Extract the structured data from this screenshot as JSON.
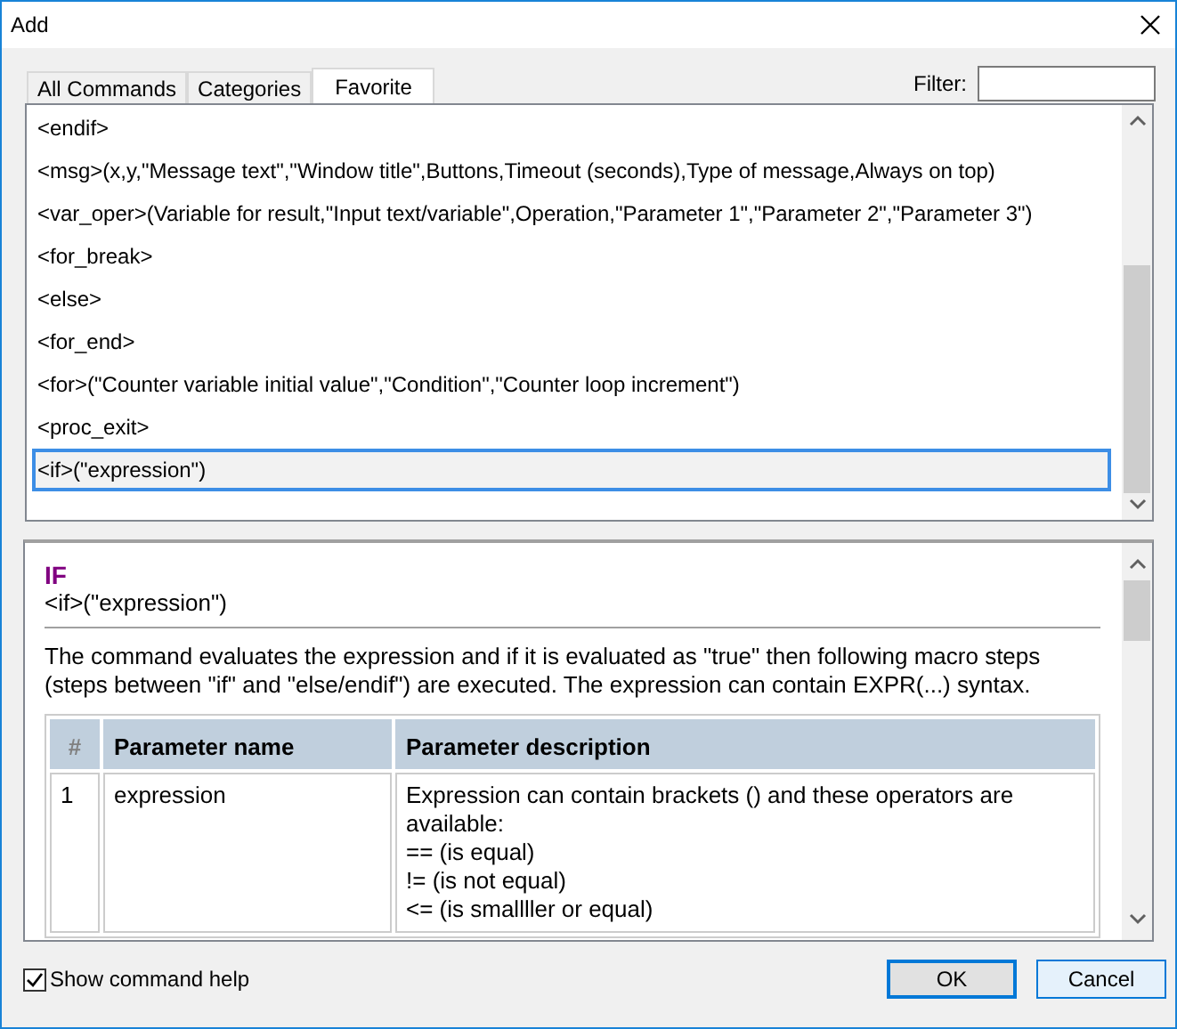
{
  "window": {
    "title": "Add"
  },
  "tabs": [
    {
      "label": "All Commands",
      "selected": false
    },
    {
      "label": "Categories",
      "selected": false
    },
    {
      "label": "Favorite",
      "selected": true
    }
  ],
  "filter": {
    "label": "Filter:"
  },
  "commands": [
    {
      "text": "<endif>",
      "selected": false
    },
    {
      "text": "<msg>(x,y,\"Message text\",\"Window title\",Buttons,Timeout (seconds),Type of message,Always on top)",
      "selected": false
    },
    {
      "text": "<var_oper>(Variable for result,\"Input text/variable\",Operation,\"Parameter 1\",\"Parameter 2\",\"Parameter 3\")",
      "selected": false
    },
    {
      "text": "<for_break>",
      "selected": false
    },
    {
      "text": "<else>",
      "selected": false
    },
    {
      "text": "<for_end>",
      "selected": false
    },
    {
      "text": "<for>(\"Counter variable initial value\",\"Condition\",\"Counter loop increment\")",
      "selected": false
    },
    {
      "text": "<proc_exit>",
      "selected": false
    },
    {
      "text": "<if>(\"expression\")",
      "selected": true
    }
  ],
  "help": {
    "title": "IF",
    "syntax": "<if>(\"expression\")",
    "description": "The command evaluates the expression and if it is evaluated as \"true\" then following macro steps (steps between \"if\" and \"else/endif\") are executed. The expression can contain EXPR(...) syntax.",
    "table": {
      "columns": [
        "#",
        "Parameter name",
        "Parameter description"
      ],
      "rows": [
        {
          "number": "1",
          "name": "expression",
          "description": [
            "Expression can contain brackets () and these operators are available:",
            "== (is equal)",
            "!= (is not equal)",
            "<= (is smallller or equal)"
          ]
        }
      ]
    }
  },
  "show_help": {
    "label": "Show command help",
    "checked": true
  },
  "buttons": [
    {
      "label": "OK",
      "kind": "default"
    },
    {
      "label": "Cancel",
      "kind": "normal"
    }
  ]
}
